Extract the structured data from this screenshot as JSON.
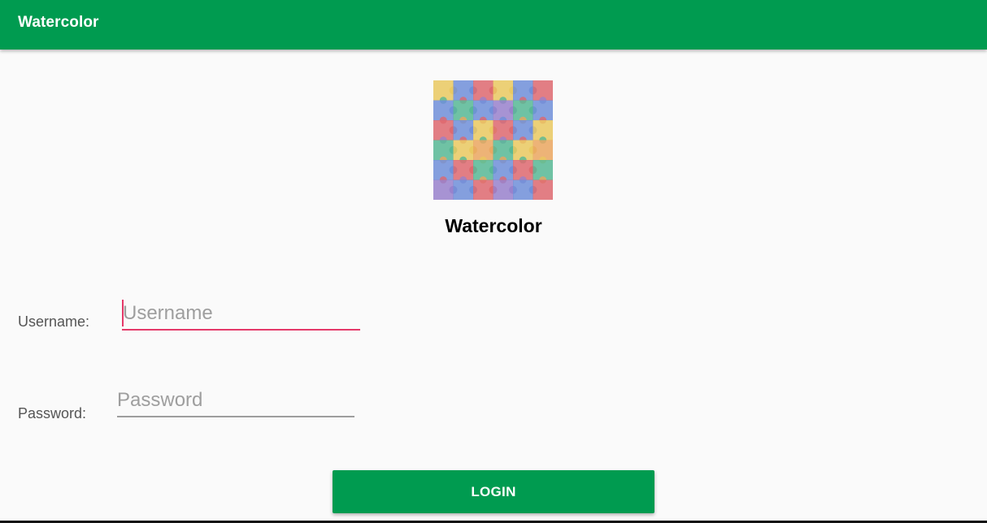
{
  "app_bar": {
    "title": "Watercolor",
    "color": "#009b50"
  },
  "logo": {
    "icon": "puzzle-pieces-logo",
    "colors": [
      "#5b7fd4",
      "#e6c14a",
      "#d9535a",
      "#3fae86",
      "#8a6fc4",
      "#e89a4a"
    ]
  },
  "brand": {
    "title": "Watercolor"
  },
  "form": {
    "username_label": "Username:",
    "username_placeholder": "Username",
    "username_value": "",
    "password_label": "Password:",
    "password_placeholder": "Password",
    "password_value": "",
    "focus_color": "#e53969"
  },
  "login_button": {
    "label": "LOGIN",
    "color": "#009b50"
  }
}
